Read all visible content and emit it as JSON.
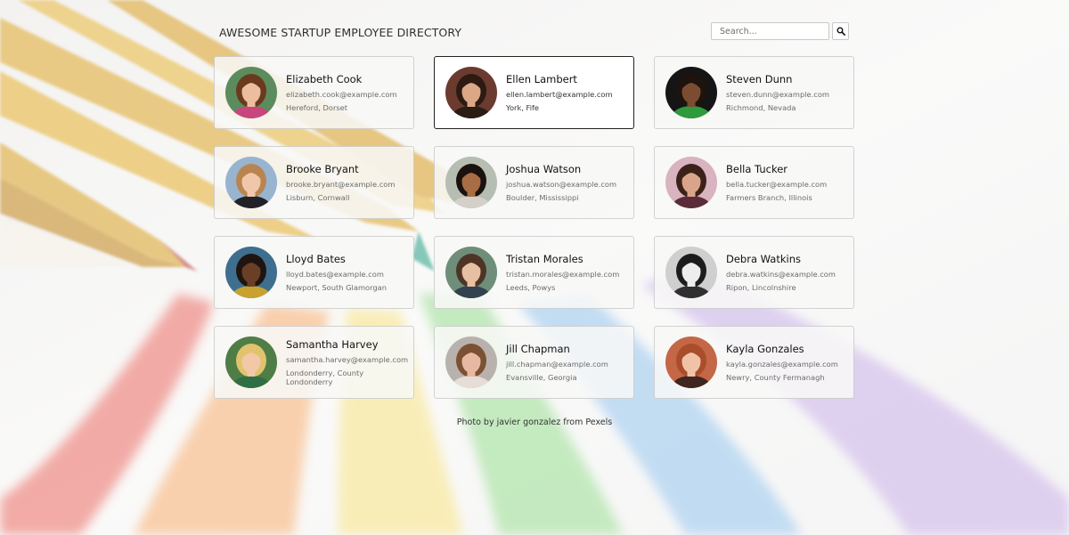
{
  "header": {
    "title": "AWESOME STARTUP EMPLOYEE DIRECTORY",
    "search_placeholder": "Search...",
    "search_icon": "magnifier-icon"
  },
  "employees": [
    {
      "name": "Elizabeth Cook",
      "email": "elizabeth.cook@example.com",
      "location": "Hereford, Dorset",
      "skin": "#eebd9f",
      "hair": "#6a3a1e",
      "shirt": "#c9467c",
      "bg": "#5c8c5e"
    },
    {
      "name": "Ellen Lambert",
      "email": "ellen.lambert@example.com",
      "location": "York, Fife",
      "skin": "#dba786",
      "hair": "#2d1a12",
      "shirt": "#2b1c16",
      "bg": "#6b3b2f"
    },
    {
      "name": "Steven Dunn",
      "email": "steven.dunn@example.com",
      "location": "Richmond, Nevada",
      "skin": "#7b4c32",
      "hair": "#1e130d",
      "shirt": "#2f9a3b",
      "bg": "#151515"
    },
    {
      "name": "Brooke Bryant",
      "email": "brooke.bryant@example.com",
      "location": "Lisburn, Cornwall",
      "skin": "#f0c7a8",
      "hair": "#b88551",
      "shirt": "#222226",
      "bg": "#98b4cf"
    },
    {
      "name": "Joshua Watson",
      "email": "joshua.watson@example.com",
      "location": "Boulder, Mississippi",
      "skin": "#a86d45",
      "hair": "#1a120e",
      "shirt": "#d4cfc8",
      "bg": "#b6bdb2"
    },
    {
      "name": "Bella Tucker",
      "email": "bella.tucker@example.com",
      "location": "Farmers Branch, Illinois",
      "skin": "#d9a48b",
      "hair": "#3b2219",
      "shirt": "#5a2c3a",
      "bg": "#d8b3c0"
    },
    {
      "name": "Lloyd Bates",
      "email": "lloyd.bates@example.com",
      "location": "Newport, South Glamorgan",
      "skin": "#6a3f26",
      "hair": "#1f1510",
      "shirt": "#c8a230",
      "bg": "#3e6f8f"
    },
    {
      "name": "Tristan Morales",
      "email": "tristan.morales@example.com",
      "location": "Leeds, Powys",
      "skin": "#e7bfa3",
      "hair": "#4e3425",
      "shirt": "#33424f",
      "bg": "#6f8e7a"
    },
    {
      "name": "Debra Watkins",
      "email": "debra.watkins@example.com",
      "location": "Ripon, Lincolnshire",
      "skin": "#ededed",
      "hair": "#1c1c1c",
      "shirt": "#303030",
      "bg": "#cfcfcf"
    },
    {
      "name": "Samantha Harvey",
      "email": "samantha.harvey@example.com",
      "location": "Londonderry, County Londonderry",
      "skin": "#f2c8a7",
      "hair": "#e1c36d",
      "shirt": "#2f6f44",
      "bg": "#4f7d46"
    },
    {
      "name": "Jill Chapman",
      "email": "jill.chapman@example.com",
      "location": "Evansville, Georgia",
      "skin": "#e8b9a2",
      "hair": "#7b5033",
      "shirt": "#e6ddd6",
      "bg": "#b9b1ad"
    },
    {
      "name": "Kayla Gonzales",
      "email": "kayla.gonzales@example.com",
      "location": "Newry, County Fermanagh",
      "skin": "#f0c3a6",
      "hair": "#a94d2a",
      "shirt": "#3f2620",
      "bg": "#c46746"
    }
  ],
  "active_index": 1,
  "footer": {
    "credit": "Photo by javier gonzalez from Pexels"
  }
}
